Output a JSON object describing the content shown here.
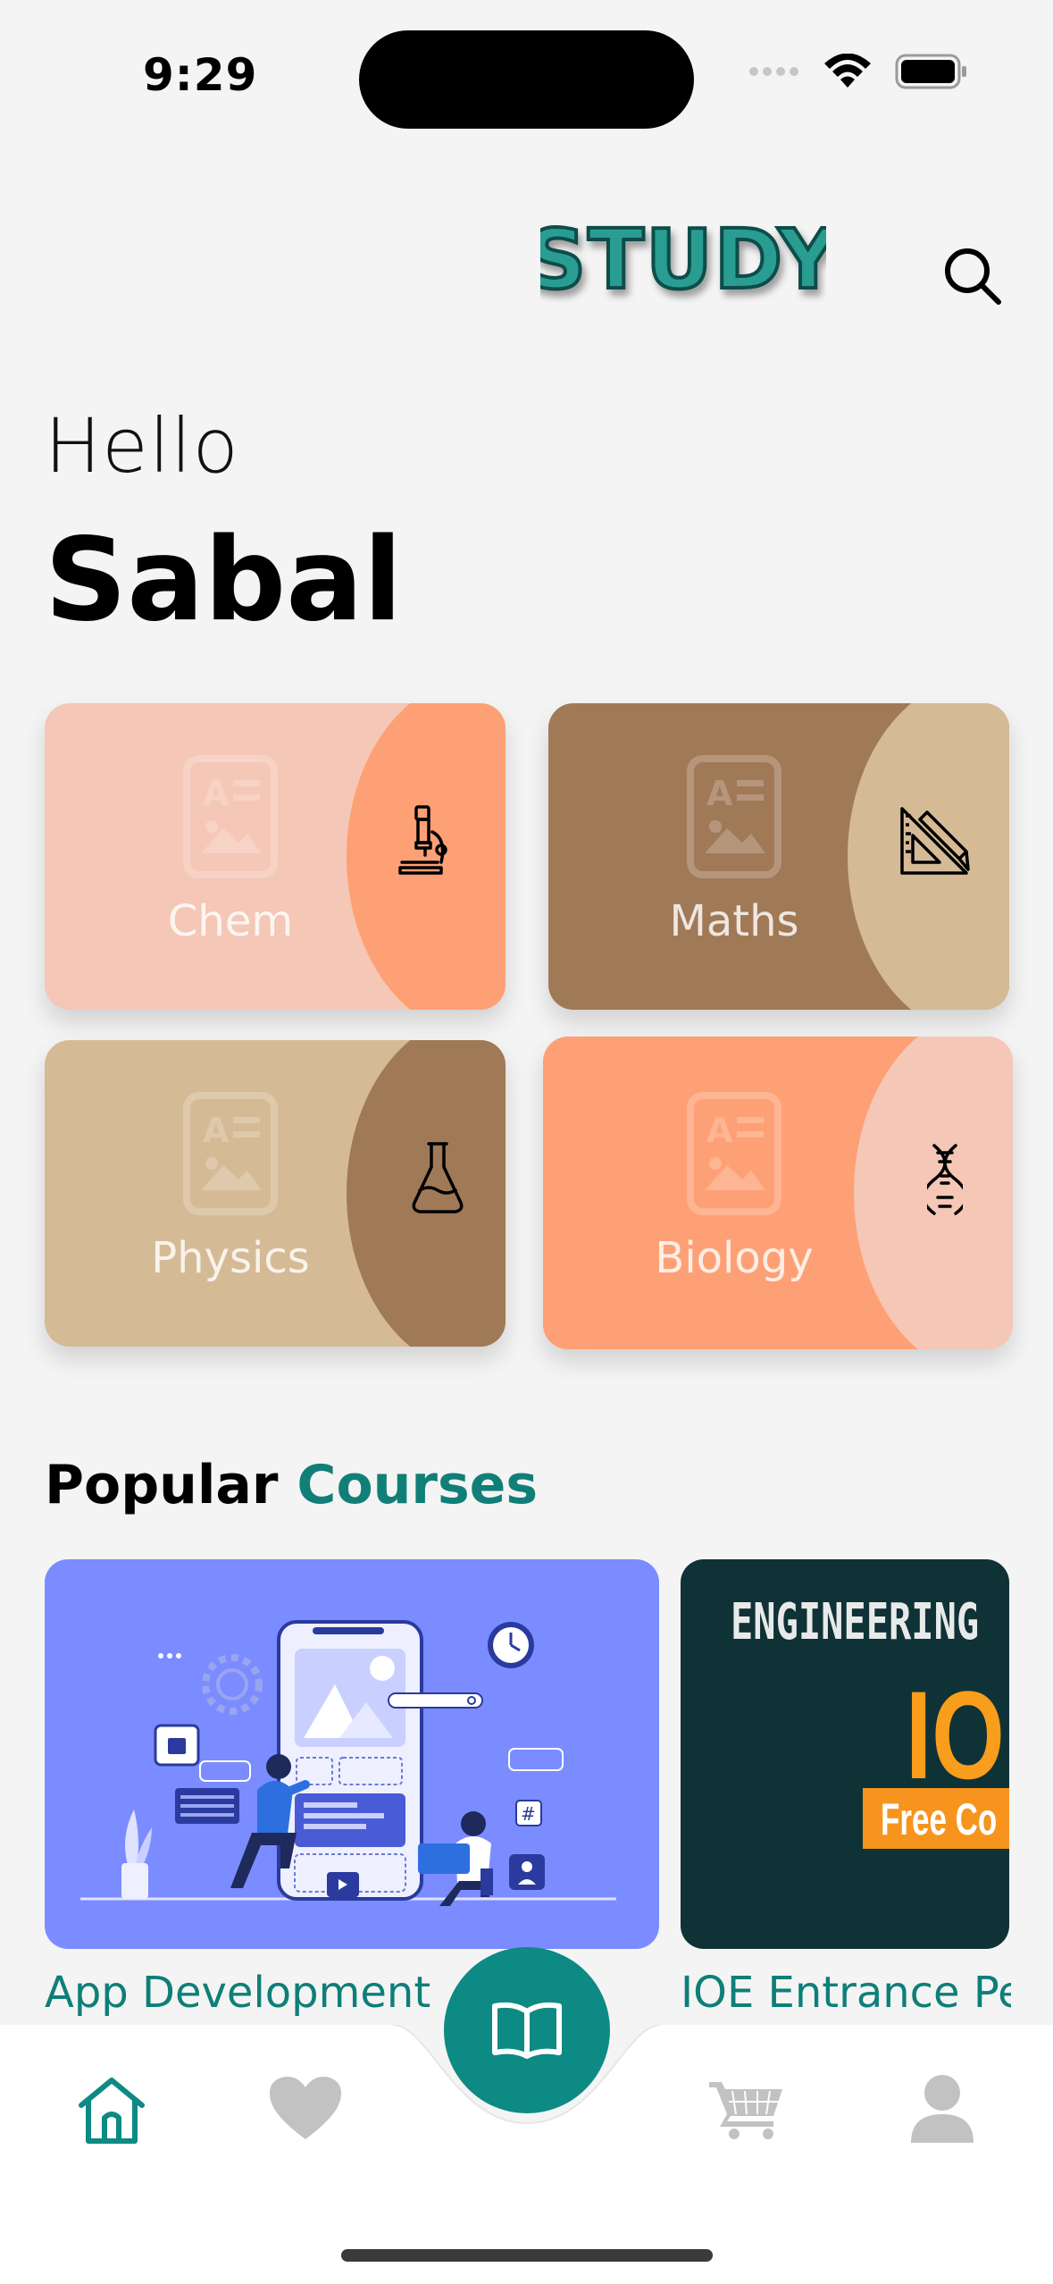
{
  "status": {
    "time": "9:29"
  },
  "header": {
    "logo_text": "STUDY",
    "search_icon": "search-icon"
  },
  "greeting": {
    "hello": "Hello",
    "name": "Sabal"
  },
  "subjects": [
    {
      "label": "Chem",
      "icon": "microscope-icon",
      "bg": "#f5c7b6",
      "blob": "#fea075"
    },
    {
      "label": "Maths",
      "icon": "ruler-triangle-icon",
      "bg": "#a07957",
      "blob": "#d5ba96"
    },
    {
      "label": "Physics",
      "icon": "flask-icon",
      "bg": "#d5ba96",
      "blob": "#a07957"
    },
    {
      "label": "Biology",
      "icon": "dna-icon",
      "bg": "#fea075",
      "blob": "#f5c7b6"
    }
  ],
  "popular": {
    "title_main": "Popular",
    "title_accent": "Courses",
    "courses": [
      {
        "title": "App Development",
        "image": "app-development-illustration"
      },
      {
        "title": "IOE Entrance Pe",
        "image_text_1": "ENGINEERING",
        "image_text_2": "IOI",
        "image_text_3": "Free Co"
      }
    ]
  },
  "nav": {
    "items": [
      "home-icon",
      "heart-icon",
      "book-icon",
      "cart-icon",
      "profile-icon"
    ],
    "active": "home-icon"
  },
  "colors": {
    "accent": "#0d8a83",
    "background": "#f4f4f4"
  }
}
